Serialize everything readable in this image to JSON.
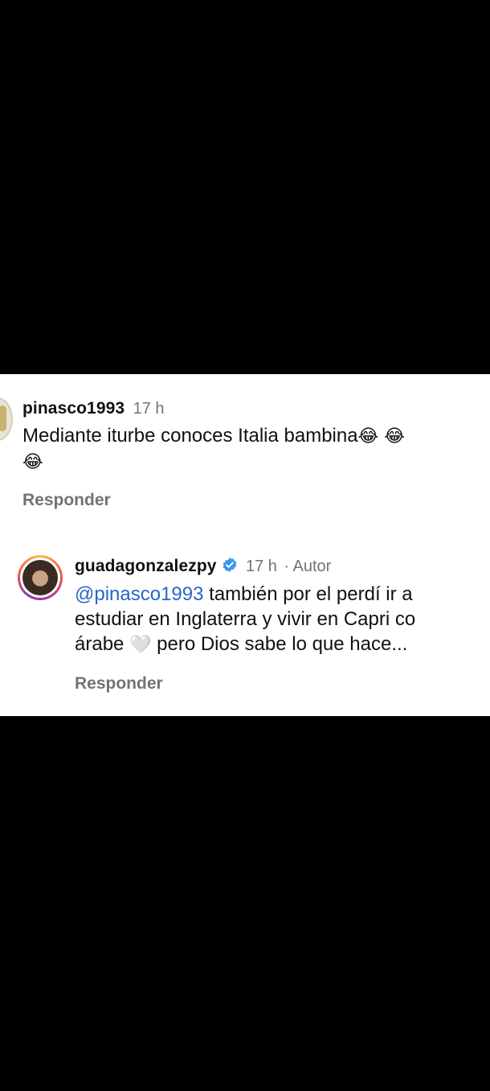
{
  "comment": {
    "username": "pinasco1993",
    "time": "17 h",
    "text_line1": "Mediante iturbe conoces Italia bambina",
    "emoji_inline": "😂 😂",
    "emoji_line2": "😂",
    "reply_label": "Responder"
  },
  "reply": {
    "username": "guadagonzalezpy",
    "time": "17 h",
    "author_label": "· Autor",
    "mention": "@pinasco1993",
    "text_line1": " también por el perdí ir a",
    "text_line2": "estudiar en Inglaterra y vivir en Capri co",
    "text_line3_a": "árabe",
    "heart": "🤍",
    "text_line3_b": " pero Dios sabe lo que hace...",
    "reply_label": "Responder"
  },
  "colors": {
    "mention": "#2766c9",
    "verified": "#3897f0",
    "secondary_text": "#737373"
  },
  "icons": [
    "verified-badge-icon"
  ]
}
